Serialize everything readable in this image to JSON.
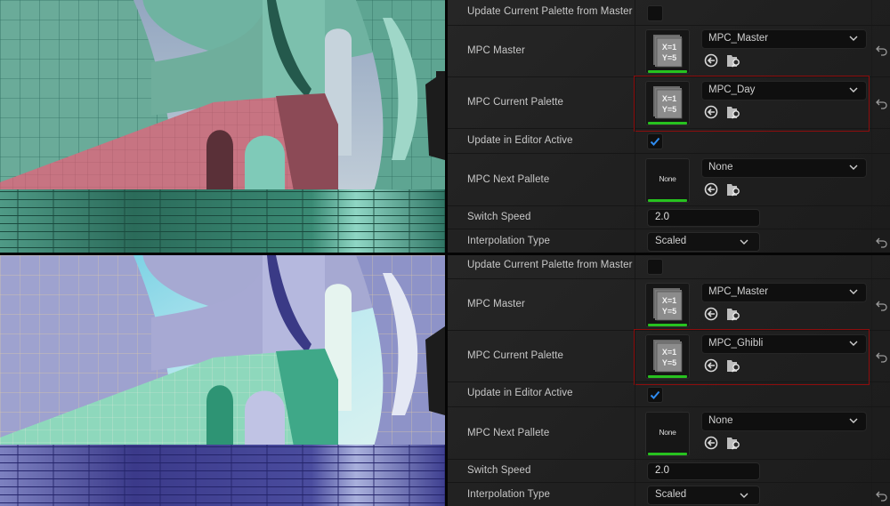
{
  "panels": [
    {
      "scene_name": "day-scene",
      "properties": {
        "update_from_master": {
          "label": "Update Current Palette from Master",
          "checked": false
        },
        "mpc_master": {
          "label": "MPC Master",
          "value": "MPC_Master",
          "thumb_icon": "material-parameter-collection-icon",
          "thumb_text_1": "X=1",
          "thumb_text_2": "Y=5"
        },
        "mpc_current": {
          "label": "MPC Current Palette",
          "value": "MPC_Day",
          "thumb_icon": "material-parameter-collection-icon",
          "thumb_text_1": "X=1",
          "thumb_text_2": "Y=5"
        },
        "update_in_editor": {
          "label": "Update in Editor Active",
          "checked": true
        },
        "mpc_next": {
          "label": "MPC Next Pallete",
          "value": "None",
          "thumb_text": "None"
        },
        "switch_speed": {
          "label": "Switch Speed",
          "value": "2.0"
        },
        "interpolation": {
          "label": "Interpolation Type",
          "value": "Scaled"
        }
      }
    },
    {
      "scene_name": "ghibli-scene",
      "properties": {
        "update_from_master": {
          "label": "Update Current Palette from Master",
          "checked": false
        },
        "mpc_master": {
          "label": "MPC Master",
          "value": "MPC_Master",
          "thumb_icon": "material-parameter-collection-icon",
          "thumb_text_1": "X=1",
          "thumb_text_2": "Y=5"
        },
        "mpc_current": {
          "label": "MPC Current Palette",
          "value": "MPC_Ghibli",
          "thumb_icon": "material-parameter-collection-icon",
          "thumb_text_1": "X=1",
          "thumb_text_2": "Y=5"
        },
        "update_in_editor": {
          "label": "Update in Editor Active",
          "checked": true
        },
        "mpc_next": {
          "label": "MPC Next Pallete",
          "value": "None",
          "thumb_text": "None"
        },
        "switch_speed": {
          "label": "Switch Speed",
          "value": "2.0"
        },
        "interpolation": {
          "label": "Interpolation Type",
          "value": "Scaled"
        }
      }
    }
  ],
  "colors": {
    "highlight_border": "#8e0d0d",
    "asset_bar": "#27c21f",
    "checkbox_check": "#2f8cf0",
    "day_wall": "#6fb3a1",
    "day_bridge": "#c77482",
    "day_stairs": "#2b6b5a",
    "day_sky": "#9fb0c6",
    "ghibli_wall": "#a9acd4",
    "ghibli_bridge": "#6fcfa8",
    "ghibli_stairs": "#3b3a8a",
    "ghibli_sky": "#7fd6e6"
  }
}
